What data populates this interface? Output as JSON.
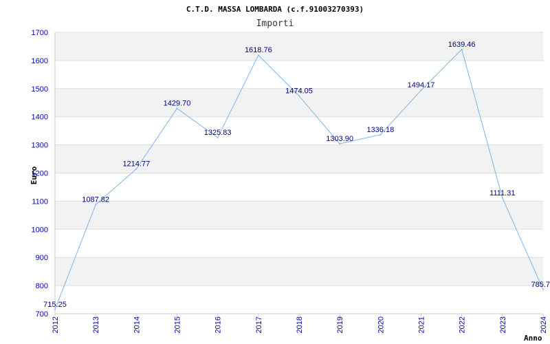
{
  "chart_data": {
    "type": "line",
    "title": "C.T.D. MASSA LOMBARDA (c.f.91003270393)",
    "subtitle": "Importi",
    "xlabel": "Anno",
    "ylabel": "Euro",
    "x": [
      "2012",
      "2013",
      "2014",
      "2015",
      "2016",
      "2017",
      "2018",
      "2019",
      "2020",
      "2021",
      "2022",
      "2023",
      "2024"
    ],
    "values": [
      715.25,
      1087.82,
      1214.77,
      1429.7,
      1325.83,
      1618.76,
      1474.05,
      1303.9,
      1336.18,
      1494.17,
      1639.46,
      1111.31,
      785.7
    ],
    "data_labels": [
      "715.25",
      "1087.82",
      "1214.77",
      "1429.70",
      "1325.83",
      "1618.76",
      "1474.05",
      "1303.90",
      "1336.18",
      "1494.17",
      "1639.46",
      "1111.31",
      "785.7"
    ],
    "yticks": [
      700,
      800,
      900,
      1000,
      1100,
      1200,
      1300,
      1400,
      1500,
      1600,
      1700
    ],
    "ylim": [
      700,
      1700
    ],
    "grid": true,
    "legend": "none",
    "colors": {
      "line": "#7ab4ea",
      "band": "#f2f2f2",
      "grid": "#dddddd",
      "tick_text": "#0000aa",
      "label_text": "#000080"
    }
  }
}
